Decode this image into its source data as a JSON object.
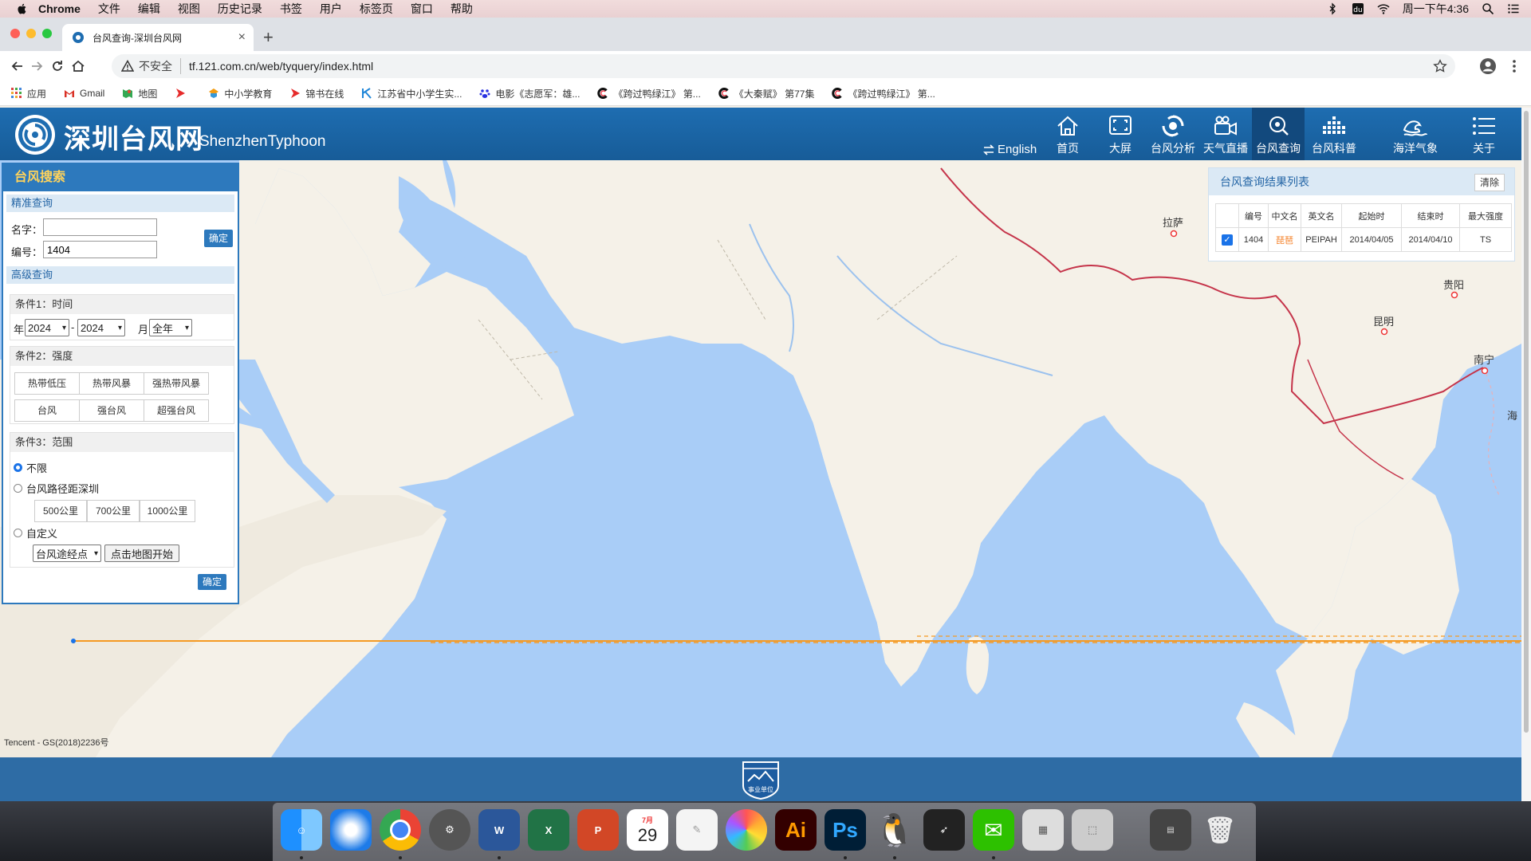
{
  "menubar": {
    "app": "Chrome",
    "items": [
      "文件",
      "编辑",
      "视图",
      "历史记录",
      "书签",
      "用户",
      "标签页",
      "窗口",
      "帮助"
    ],
    "clock": "周一下午4:36"
  },
  "browser": {
    "tab_title": "台风查询-深圳台风网",
    "security_label": "不安全",
    "url": "tf.121.com.cn/web/tyquery/index.html",
    "bookmarks": [
      "应用",
      "Gmail",
      "地图",
      "",
      "中小学教育",
      "锦书在线",
      "江苏省中小学生实...",
      "电影《志愿军：雄...",
      "《跨过鸭绿江》 第...",
      "《大秦赋》 第77集",
      "《跨过鸭绿江》 第..."
    ]
  },
  "header": {
    "title": "深圳台风网",
    "subtitle": "ShenzhenTyphoon",
    "english_label": "English",
    "nav": [
      {
        "label": "首页",
        "icon": "home-icon"
      },
      {
        "label": "大屏",
        "icon": "fullscreen-icon"
      },
      {
        "label": "台风分析",
        "icon": "typhoon-icon"
      },
      {
        "label": "天气直播",
        "icon": "video-camera-icon"
      },
      {
        "label": "台风查询",
        "icon": "search-icon"
      },
      {
        "label": "台风科普",
        "icon": "bar-chart-icon"
      },
      {
        "label": "海洋气象",
        "icon": "wave-icon"
      },
      {
        "label": "关于",
        "icon": "menu-list-icon"
      }
    ],
    "active_nav": "台风查询"
  },
  "search_panel": {
    "title": "台风搜索",
    "exact": {
      "section": "精准查询",
      "name_label": "名字：",
      "name_value": "",
      "number_label": "编号：",
      "number_value": "1404",
      "confirm": "确定"
    },
    "advanced": {
      "section": "高级查询",
      "cond1_title": "条件1：时间",
      "year_label": "年",
      "year_from": "2024",
      "dash": "-",
      "year_to": "2024",
      "month_label": "月",
      "month_value": "全年",
      "cond2_title": "条件2：强度",
      "intensity": [
        "热带低压",
        "热带风暴",
        "强热带风暴",
        "台风",
        "强台风",
        "超强台风"
      ],
      "cond3_title": "条件3：范围",
      "range_unlimited": "不限",
      "range_distance": "台风路径距深圳",
      "distances": [
        "500公里",
        "700公里",
        "1000公里"
      ],
      "range_custom": "自定义",
      "custom_select": "台风途经点",
      "map_start": "点击地图开始",
      "confirm": "确定"
    }
  },
  "results_panel": {
    "title": "台风查询结果列表",
    "clear": "清除",
    "columns": [
      "编号",
      "中文名",
      "英文名",
      "起始时",
      "结束时",
      "最大强度"
    ],
    "rows": [
      {
        "number": "1404",
        "cn_name": "琵琶",
        "en_name": "PEIPAH",
        "start": "2014/04/05",
        "end": "2014/04/10",
        "max_intensity": "TS",
        "checked": true
      }
    ]
  },
  "map": {
    "credit": "Tencent - GS(2018)2236号",
    "labels": [
      "拉萨",
      "贵阳",
      "昆明",
      "南宁",
      "海"
    ],
    "track_color": "#f59a23"
  },
  "footer": {
    "badge_text": "事业单位"
  },
  "dock": {
    "calendar_month": "7月",
    "calendar_day": "29"
  }
}
